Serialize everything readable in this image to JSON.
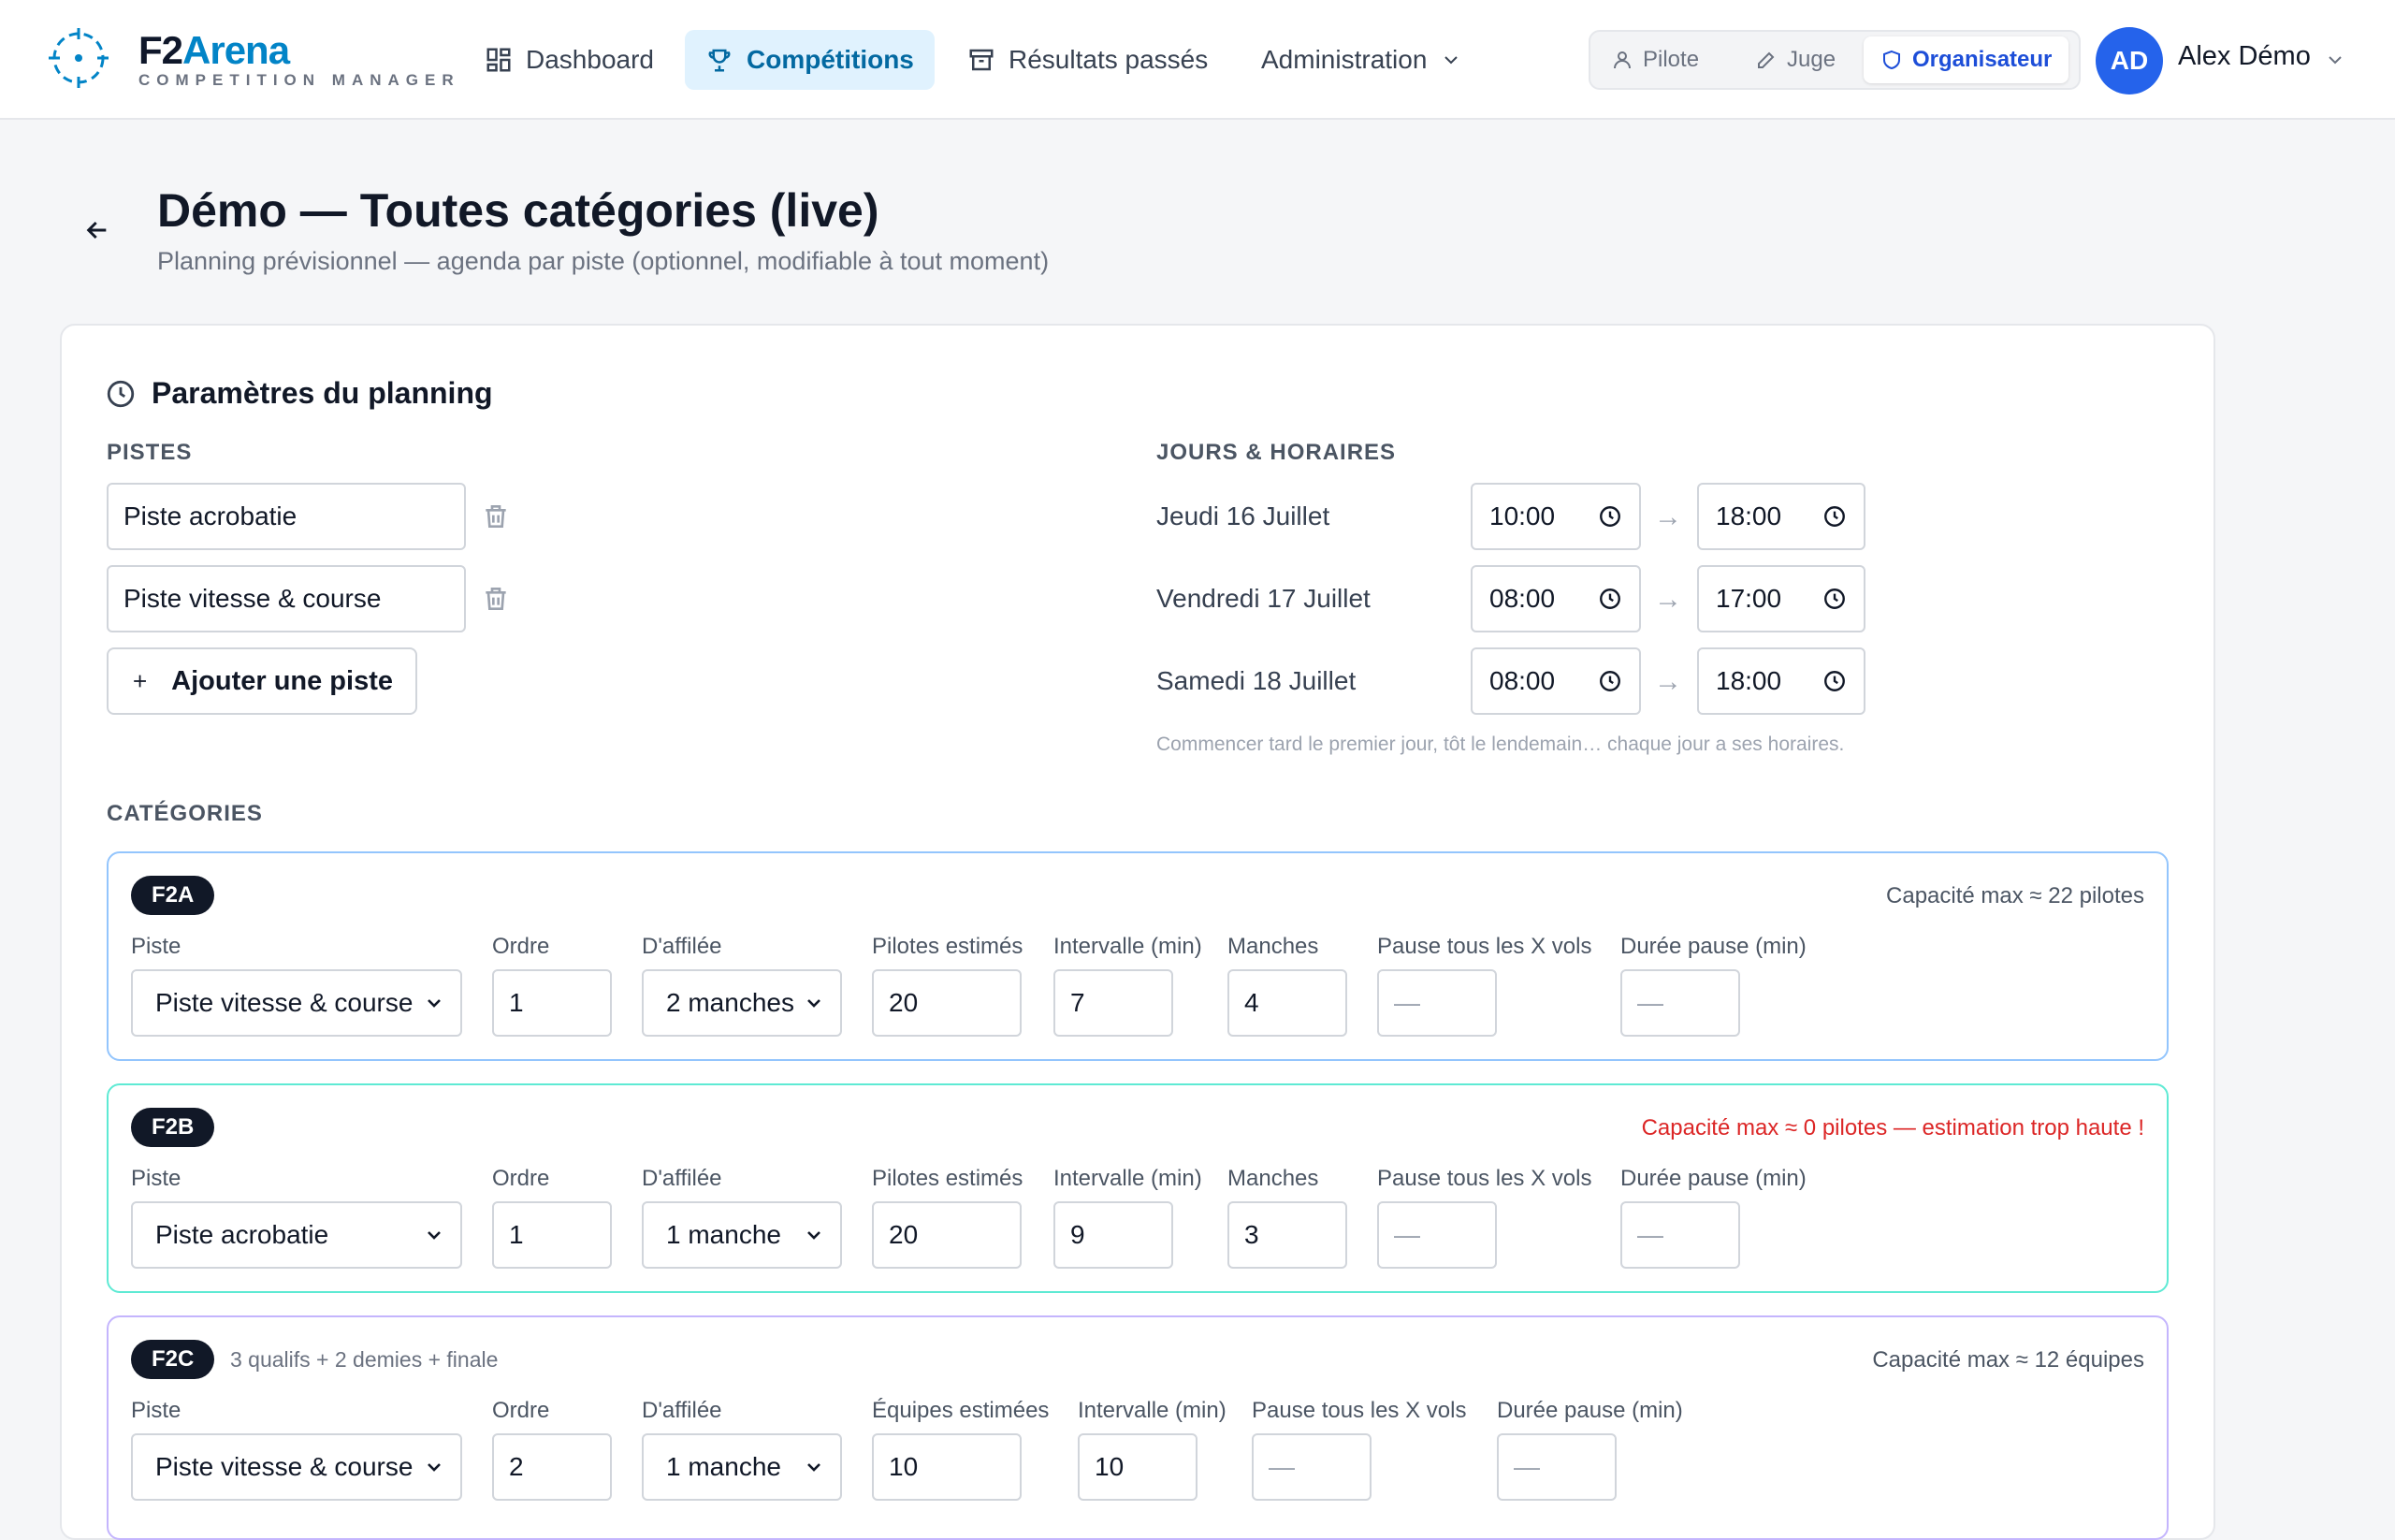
{
  "brand": {
    "name_part1": "F2",
    "name_part2": "Arena",
    "subtitle": "COMPETITION MANAGER"
  },
  "nav": {
    "dashboard": "Dashboard",
    "competitions": "Compétitions",
    "past_results": "Résultats passés",
    "admin": "Administration"
  },
  "roles": {
    "pilot": "Pilote",
    "judge": "Juge",
    "organizer": "Organisateur",
    "active": "Organisateur"
  },
  "user": {
    "initials": "AD",
    "name": "Alex Démo"
  },
  "colors": {
    "accent": "#0284c7",
    "active_role": "#1d4ed8",
    "avatar": "#2563eb",
    "warning": "#dc2626",
    "f2a_border": "#93c5fd",
    "f2b_border": "#5eead4",
    "f2c_border": "#c4b5fd"
  },
  "page": {
    "title": "Démo — Toutes catégories (live)",
    "subtitle": "Planning prévisionnel — agenda par piste (optionnel, modifiable à tout moment)"
  },
  "planning": {
    "title": "Paramètres du planning",
    "tracks_label": "PISTES",
    "tracks": [
      "Piste acrobatie",
      "Piste vitesse & course"
    ],
    "add_track": "Ajouter une piste",
    "days_label": "JOURS & HORAIRES",
    "days": [
      {
        "label": "Jeudi 16 Juillet",
        "start": "10:00",
        "end": "18:00"
      },
      {
        "label": "Vendredi 17 Juillet",
        "start": "08:00",
        "end": "17:00"
      },
      {
        "label": "Samedi 18 Juillet",
        "start": "08:00",
        "end": "18:00"
      }
    ],
    "arrow": "→",
    "days_hint": "Commencer tard le premier jour, tôt le lendemain… chaque jour a ses horaires."
  },
  "categories_label": "CATÉGORIES",
  "labels": {
    "track": "Piste",
    "order": "Ordre",
    "consecutive": "D'affilée",
    "pilots": "Pilotes estimés",
    "teams": "Équipes estimées",
    "interval": "Intervalle (min)",
    "rounds": "Manches",
    "pause_every": "Pause tous les X vols",
    "pause_duration": "Durée pause (min)"
  },
  "categories": [
    {
      "badge": "F2A",
      "capacity": "Capacité max ≈ 22 pilotes",
      "track": "Piste vitesse & course",
      "order": "1",
      "consecutive": "2 manches",
      "estimated": "20",
      "interval": "7",
      "rounds": "4",
      "pause_every": "—",
      "pause_duration": "—"
    },
    {
      "badge": "F2B",
      "capacity": "Capacité max ≈ 0 pilotes — estimation trop haute !",
      "track": "Piste acrobatie",
      "order": "1",
      "consecutive": "1 manche",
      "estimated": "20",
      "interval": "9",
      "rounds": "3",
      "pause_every": "—",
      "pause_duration": "—"
    },
    {
      "badge": "F2C",
      "extra": "3 qualifs + 2 demies + finale",
      "capacity": "Capacité max ≈ 12 équipes",
      "track": "Piste vitesse & course",
      "order": "2",
      "consecutive": "1 manche",
      "estimated": "10",
      "interval": "10",
      "pause_every": "—",
      "pause_duration": "—"
    }
  ]
}
